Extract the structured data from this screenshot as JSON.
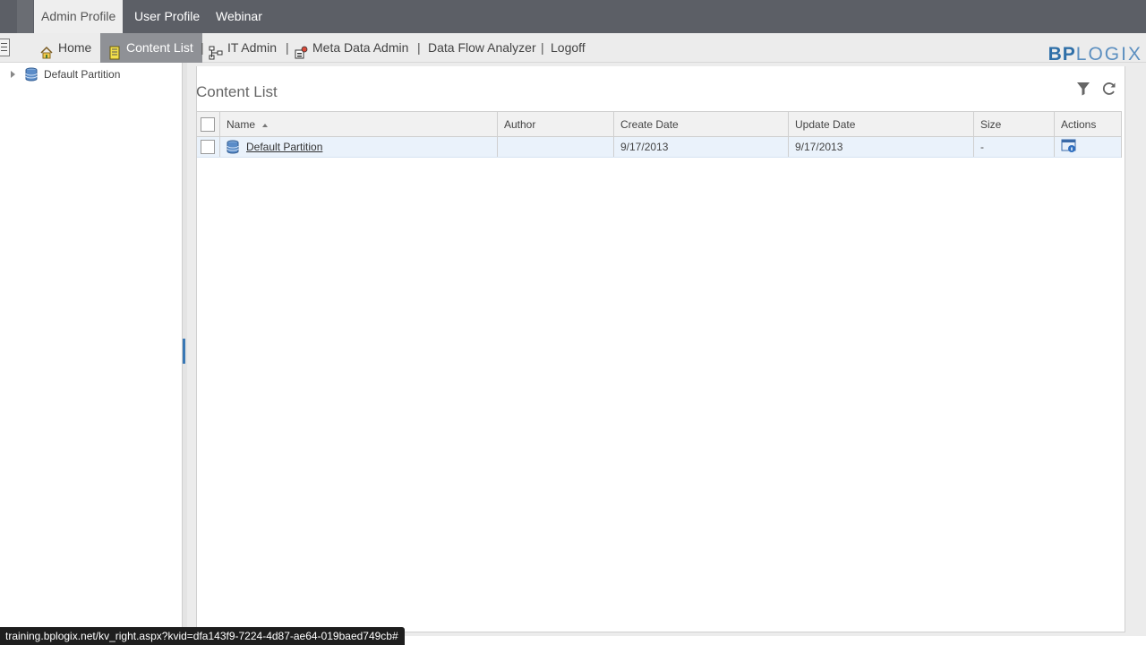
{
  "profile_tabs": [
    {
      "label": "Admin Profile",
      "active": true
    },
    {
      "label": "User Profile",
      "active": false
    },
    {
      "label": "Webinar",
      "active": false
    }
  ],
  "nav": {
    "items": [
      {
        "label": "Home",
        "icon": "home-icon"
      },
      {
        "label": "Content List",
        "icon": "content-list-icon",
        "active": true
      },
      {
        "label": "IT Admin",
        "icon": "it-admin-icon"
      },
      {
        "label": "Meta Data Admin",
        "icon": "metadata-admin-icon"
      },
      {
        "label": "Data Flow Analyzer"
      },
      {
        "label": "Logoff"
      }
    ],
    "separator": "|"
  },
  "logo": {
    "bold": "BP",
    "light": "LOGIX",
    "color": "#2f6fa8"
  },
  "tree": {
    "root_label": "Default Partition"
  },
  "content": {
    "title": "Content List",
    "tools": [
      {
        "icon": "filter-icon"
      },
      {
        "icon": "refresh-icon"
      }
    ],
    "columns": [
      "Name",
      "Author",
      "Create Date",
      "Update Date",
      "Size",
      "Actions"
    ],
    "rows": [
      {
        "name": "Default Partition",
        "author": "",
        "create_date": "9/17/2013",
        "update_date": "9/17/2013",
        "size": "-",
        "action_icon": "properties-icon"
      }
    ]
  },
  "status_bar": {
    "text": "training.bplogix.net/kv_right.aspx?kvid=dfa143f9-7224-4d87-ae64-019baed749cb#"
  }
}
